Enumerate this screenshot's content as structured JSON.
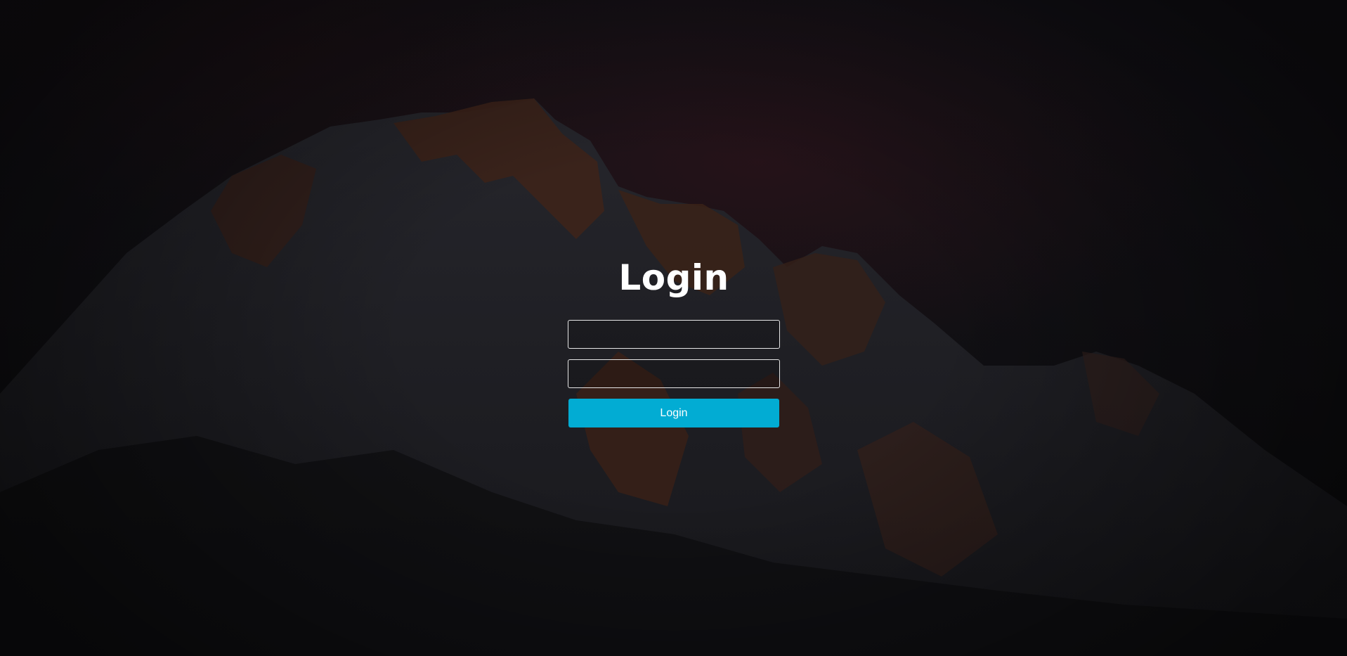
{
  "login": {
    "title": "Login",
    "username_field": {
      "value": "",
      "placeholder": ""
    },
    "password_field": {
      "value": "",
      "placeholder": ""
    },
    "submit_label": "Login"
  },
  "colors": {
    "accent": "#02acd3",
    "text": "#ffffff",
    "field_border": "#e6e6e6"
  }
}
